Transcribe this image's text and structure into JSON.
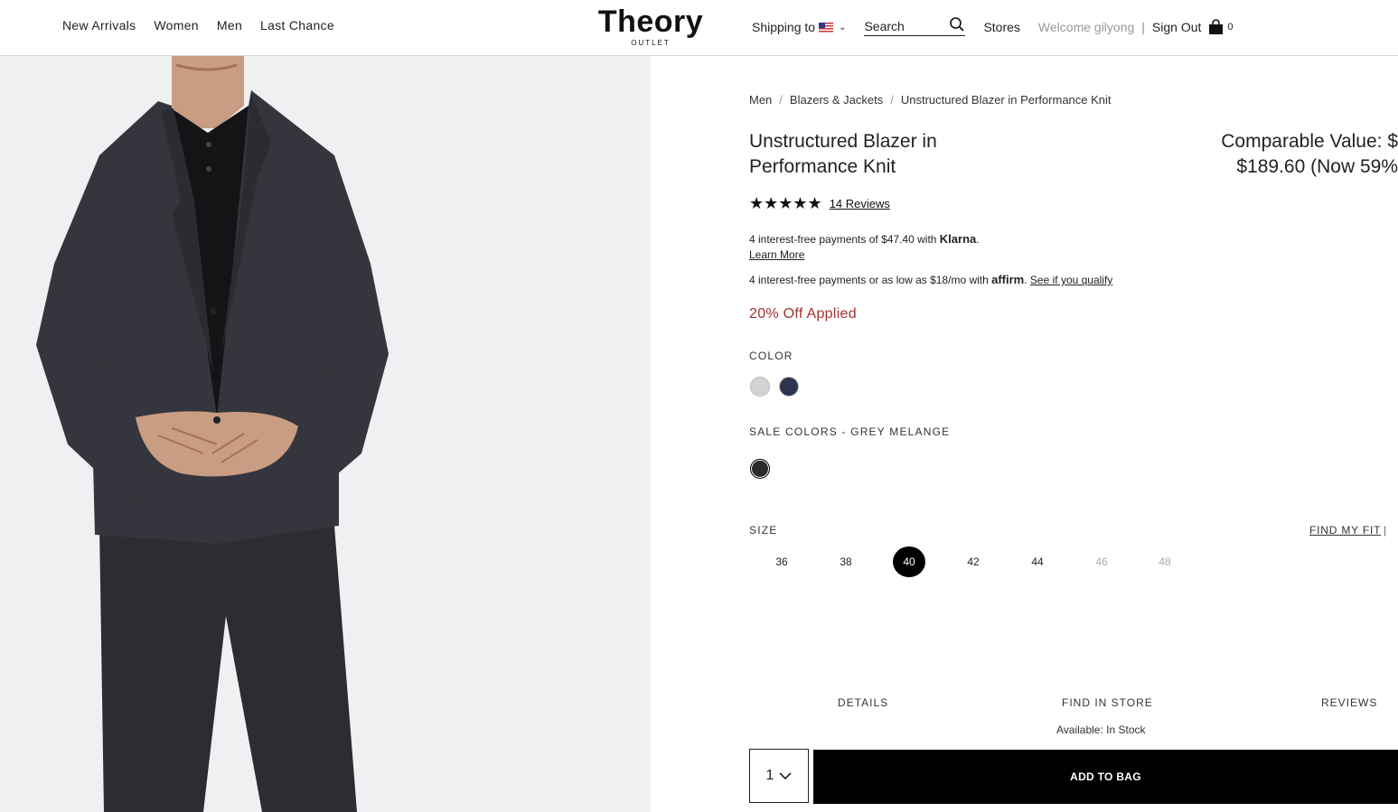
{
  "header": {
    "nav_left": [
      "New Arrivals",
      "Women",
      "Men",
      "Last Chance"
    ],
    "logo_main": "Theory",
    "logo_sub": "OUTLET",
    "shipping_label": "Shipping to",
    "search_placeholder": "Search",
    "stores": "Stores",
    "welcome": "Welcome gilyong",
    "separator": "|",
    "sign_out": "Sign Out",
    "bag_count": "0"
  },
  "breadcrumb": {
    "items": [
      "Men",
      "Blazers & Jackets",
      "Unstructured Blazer in Performance Knit"
    ],
    "separator": "/"
  },
  "product": {
    "title": "Unstructured Blazer in Performance Knit",
    "comparable_line1": "Comparable Value: $",
    "comparable_line2": "$189.60 (Now 59%",
    "stars": "★★★★★",
    "reviews_link": "14 Reviews",
    "klarna_text": "4 interest-free payments of $47.40 with ",
    "klarna_brand": "Klarna",
    "klarna_period": ".",
    "learn_more": "Learn More",
    "affirm_text": "4 interest-free payments or as low as $18/mo with ",
    "affirm_brand": "affirm",
    "affirm_period": ". ",
    "affirm_link": "See if you qualify",
    "promo": "20% Off Applied"
  },
  "color": {
    "label": "COLOR",
    "swatches": [
      {
        "name": "light grey",
        "hex": "#d3d3d3"
      },
      {
        "name": "navy",
        "hex": "#2e3350"
      }
    ]
  },
  "sale_colors": {
    "label": "SALE COLORS - GREY MELANGE",
    "swatches": [
      {
        "name": "grey melange",
        "hex": "#2b2b2b"
      }
    ]
  },
  "size": {
    "label": "SIZE",
    "find_my_fit": "FIND MY FIT",
    "separator": "|",
    "options": [
      "36",
      "38",
      "40",
      "42",
      "44",
      "46",
      "48"
    ],
    "selected": "40",
    "unavailable": [
      "46",
      "48"
    ]
  },
  "tabs": {
    "details": "DETAILS",
    "find_in_store": "FIND IN STORE",
    "reviews": "REVIEWS"
  },
  "availability": "Available: In Stock",
  "purchase": {
    "quantity": "1",
    "add_to_bag": "ADD TO BAG"
  },
  "colors": {
    "promo": "#a0322e",
    "image_bg": "#f0eff1",
    "button_bg": "#000000"
  }
}
